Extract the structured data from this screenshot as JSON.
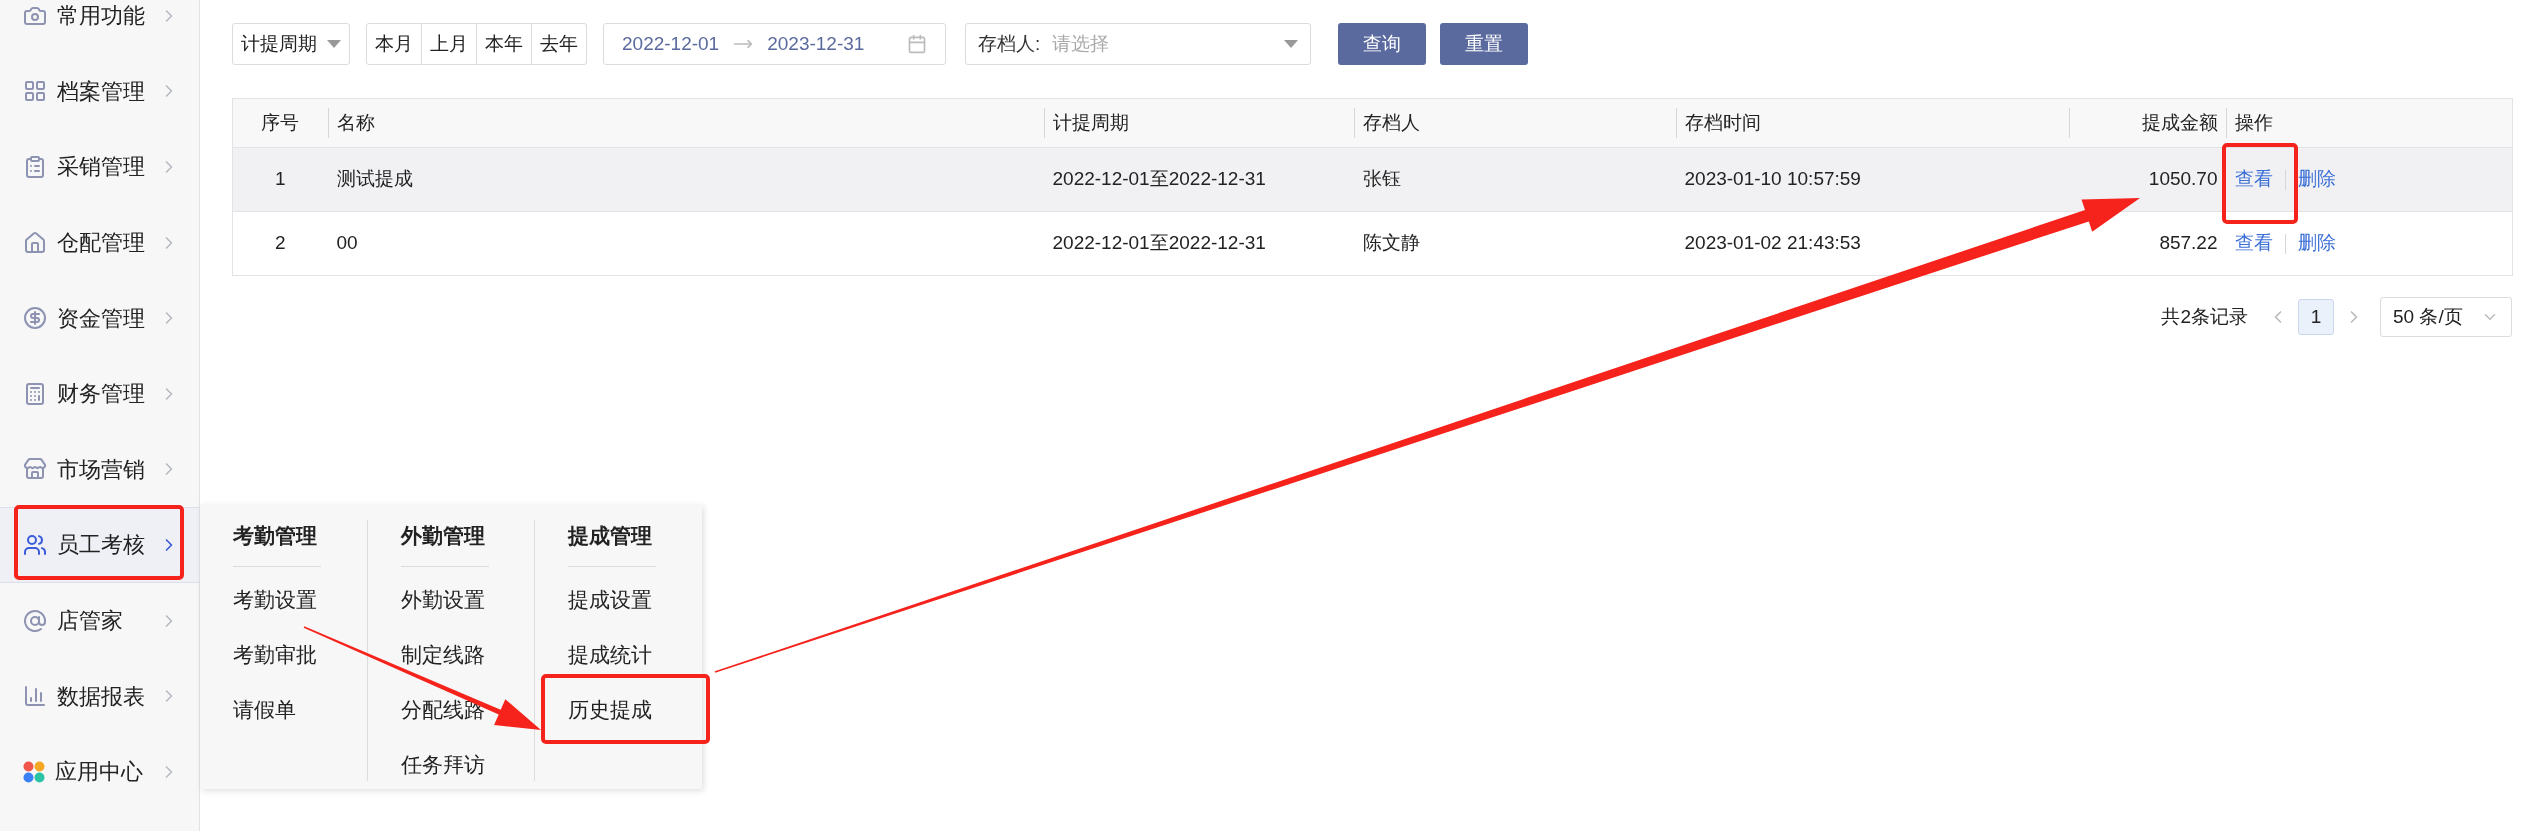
{
  "sidebar": {
    "items": [
      {
        "label": "常用功能",
        "selected": false
      },
      {
        "label": "档案管理",
        "selected": false
      },
      {
        "label": "采销管理",
        "selected": false
      },
      {
        "label": "仓配管理",
        "selected": false
      },
      {
        "label": "资金管理",
        "selected": false
      },
      {
        "label": "财务管理",
        "selected": false
      },
      {
        "label": "市场营销",
        "selected": false
      },
      {
        "label": "员工考核",
        "selected": true
      },
      {
        "label": "店管家",
        "selected": false
      },
      {
        "label": "数据报表",
        "selected": false
      },
      {
        "label": "应用中心",
        "selected": false
      }
    ]
  },
  "submenu": {
    "columns": [
      {
        "heading": "考勤管理",
        "items": [
          "考勤设置",
          "考勤审批",
          "请假单"
        ]
      },
      {
        "heading": "外勤管理",
        "items": [
          "外勤设置",
          "制定线路",
          "分配线路",
          "任务拜访"
        ]
      },
      {
        "heading": "提成管理",
        "items": [
          "提成设置",
          "提成统计",
          "历史提成"
        ]
      }
    ]
  },
  "filters": {
    "period_select": {
      "value": "计提周期"
    },
    "quick_ranges": [
      "本月",
      "上月",
      "本年",
      "去年"
    ],
    "date_range": {
      "start": "2022-12-01",
      "end": "2023-12-31"
    },
    "archiver_select": {
      "label": "存档人:",
      "placeholder": "请选择"
    },
    "buttons": [
      "查询",
      "重置"
    ]
  },
  "table": {
    "columns": [
      "序号",
      "名称",
      "计提周期",
      "存档人",
      "存档时间",
      "提成金额",
      "操作"
    ],
    "rows": [
      {
        "highlighted": true,
        "cells": [
          "1",
          "测试提成",
          "2022-12-01至2022-12-31",
          "张钰",
          "2023-01-10 10:57:59",
          "1050.70"
        ],
        "actions": [
          "查看",
          "删除"
        ]
      },
      {
        "highlighted": false,
        "cells": [
          "2",
          "00",
          "2022-12-01至2022-12-31",
          "陈文静",
          "2023-01-02 21:43:53",
          "857.22"
        ],
        "actions": [
          "查看",
          "删除"
        ]
      }
    ]
  },
  "pagination": {
    "total": "共2条记录",
    "pages": [
      {
        "label": "1",
        "selected": true
      }
    ],
    "page_size": "50 条/页"
  }
}
